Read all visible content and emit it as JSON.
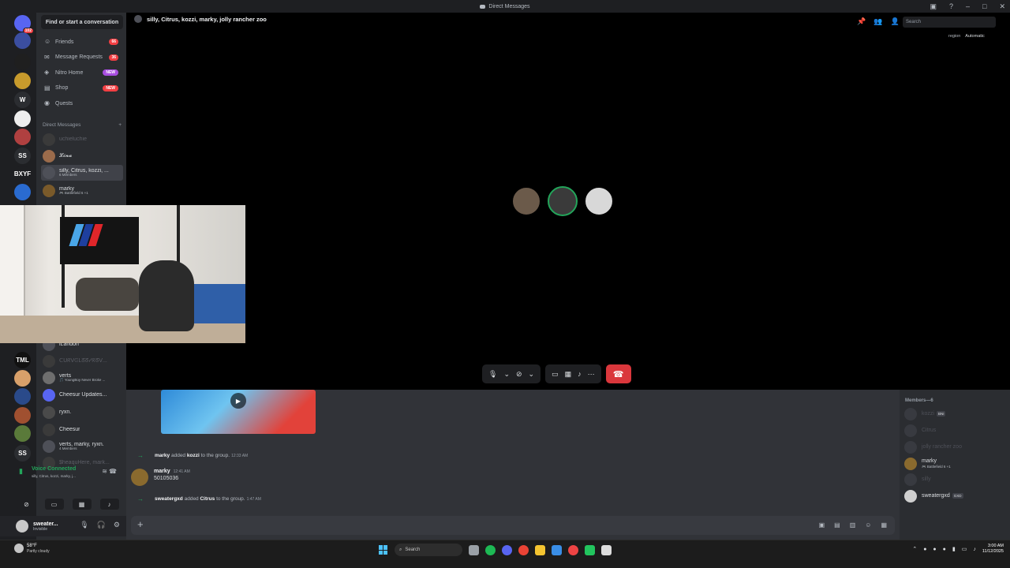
{
  "window": {
    "title": "Direct Messages"
  },
  "guilds": [
    {
      "label": "",
      "badge": "102",
      "color": "#5865f2"
    },
    {
      "label": "",
      "color": "#3b4ea0"
    },
    {
      "label": "",
      "color": "#1f1f1f"
    },
    {
      "label": "",
      "color": "#c79a2c"
    },
    {
      "label": "W",
      "color": "#2b2d31"
    },
    {
      "label": "",
      "color": "#eeeeee"
    },
    {
      "label": "",
      "color": "#b04040"
    },
    {
      "label": "SS",
      "color": "#2b2d31"
    },
    {
      "label": "BXYF",
      "color": "#1e1f22"
    },
    {
      "label": "",
      "color": "#2a6bd0"
    },
    {
      "label": "TML",
      "color": "#111111"
    },
    {
      "label": "",
      "color": "#d8a06a"
    },
    {
      "label": "",
      "color": "#2a4a8a"
    },
    {
      "label": "",
      "color": "#a05030"
    },
    {
      "label": "",
      "color": "#5a7a3a"
    },
    {
      "label": "SS",
      "color": "#2b2d31"
    }
  ],
  "sidebar": {
    "search_label": "Find or start a conversation",
    "nav": [
      {
        "label": "Friends",
        "badge": "66",
        "icon": "friends-icon"
      },
      {
        "label": "Message Requests",
        "badge": "36",
        "icon": "message-requests-icon"
      },
      {
        "label": "Nitro Home",
        "tag": "NEW",
        "icon": "nitro-icon"
      },
      {
        "label": "Shop",
        "tag": "NEW",
        "icon": "shop-icon"
      },
      {
        "label": "Quests",
        "icon": "quests-icon"
      }
    ],
    "dm_header": "Direct Messages",
    "dms": [
      {
        "name": "uchieluchie",
        "dim": true
      },
      {
        "name": "𝓛𝓲𝓷𝓪"
      },
      {
        "name": "silly, Citrus, kozzi, ...",
        "sub": "6 Members",
        "active": true
      },
      {
        "name": "marky",
        "sub": "🎮 Battlefield 6 +1"
      },
      {
        "name": "iLandon"
      },
      {
        "name": "ᑕᑌᖇᐯᕮᒪᘔᘔᓰᖇᘔᐯ...",
        "dim": true
      },
      {
        "name": "verts",
        "sub": "🎵 YoungBoy Never Broke ..."
      },
      {
        "name": "Cheesur Updates..."
      },
      {
        "name": "ryxn."
      },
      {
        "name": "Cheesur"
      },
      {
        "name": "verts, marky, ryxn.",
        "sub": "4 Members"
      },
      {
        "name": "$heaquHere, mark...",
        "dim": true
      }
    ],
    "voice": {
      "status": "Voice Connected",
      "channel": "silly, Citrus, kozzi, marky, j..."
    },
    "user": {
      "name": "sweater...",
      "status": "Invisible"
    }
  },
  "header": {
    "call_title": "silly, Citrus, kozzi, marky, jolly rancher zoo",
    "search_placeholder": "Search",
    "region_label": "region",
    "region_value": "Automatic"
  },
  "chat": {
    "system": [
      {
        "actor": "marky",
        "verb": "added",
        "target": "kozzi",
        "tail": "to the group.",
        "time": "12:33 AM"
      },
      {
        "actor": "sweatergxd",
        "verb": "added",
        "target": "Citrus",
        "tail": "to the group.",
        "time": "1:47 AM"
      }
    ],
    "message": {
      "author": "marky",
      "time": "12:41 AM",
      "text": "50105036"
    }
  },
  "members": {
    "header": "Members—6",
    "list": [
      {
        "name": "kozzi",
        "tag": "BNI",
        "dim": true
      },
      {
        "name": "Citrus",
        "dim": true
      },
      {
        "name": "jolly rancher zoo",
        "dim": true
      },
      {
        "name": "marky",
        "sub": "🎮 Battlefield 6 +1"
      },
      {
        "name": "silly",
        "dim": true
      },
      {
        "name": "sweatergxd",
        "tag": "GXD"
      }
    ]
  },
  "taskbar": {
    "weather_temp": "58°F",
    "weather_desc": "Partly cloudy",
    "search_label": "Search",
    "time": "3:00 AM",
    "date": "11/12/2025"
  },
  "colors": {
    "green": "#23a55a",
    "red": "#da373c",
    "blurple": "#5865f2"
  }
}
